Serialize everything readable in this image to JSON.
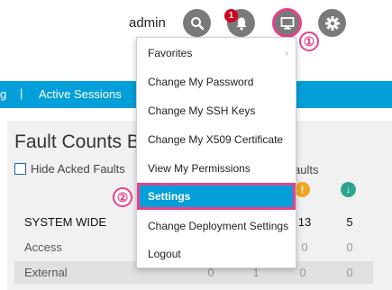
{
  "header": {
    "username": "admin",
    "notification_count": "1",
    "callout_1": "①",
    "callout_2": "②"
  },
  "navbar": {
    "partial_tab": "g",
    "separator": "|",
    "active_sessions": "Active Sessions"
  },
  "panel": {
    "title": "Fault Counts B",
    "hide_acked_label": "Hide Acked Faults",
    "faults_header": "aults",
    "rows": [
      {
        "label": "SYSTEM WIDE",
        "values": [
          "",
          "",
          "13",
          "5"
        ]
      },
      {
        "label": "Access",
        "values": [
          "",
          "",
          "0",
          "0"
        ]
      },
      {
        "label": "External",
        "values": [
          "0",
          "1",
          "0",
          "0"
        ]
      }
    ]
  },
  "menu": {
    "items": [
      {
        "label": "Favorites"
      },
      {
        "label": "Change My Password"
      },
      {
        "label": "Change My SSH Keys"
      },
      {
        "label": "Change My X509 Certificate"
      },
      {
        "label": "View My Permissions"
      },
      {
        "label": "Settings"
      },
      {
        "label": "Change Deployment Settings"
      },
      {
        "label": "Logout"
      }
    ],
    "chevron": "›"
  },
  "colors": {
    "accent": "#049fd9",
    "callout": "#e8408a",
    "warning": "#f5a623",
    "info": "#2ca58d"
  }
}
